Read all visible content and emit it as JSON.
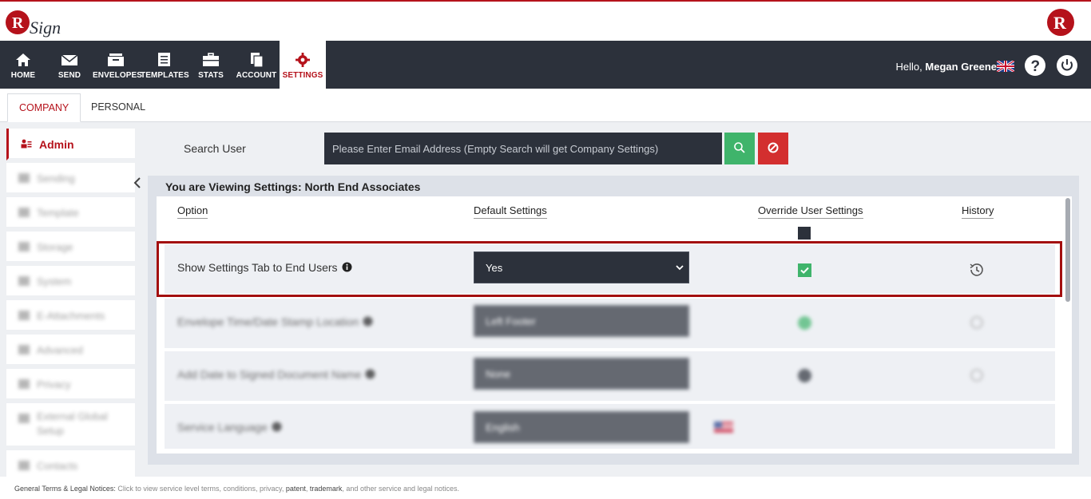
{
  "brand": {
    "logo_text": "RSign",
    "accent": "#b5121b"
  },
  "nav": {
    "items": [
      {
        "label": "HOME",
        "icon": "home-icon"
      },
      {
        "label": "SEND",
        "icon": "envelope-icon"
      },
      {
        "label": "ENVELOPES",
        "icon": "inbox-icon"
      },
      {
        "label": "TEMPLATES",
        "icon": "templates-icon"
      },
      {
        "label": "STATS",
        "icon": "briefcase-icon"
      },
      {
        "label": "ACCOUNT",
        "icon": "account-icon"
      },
      {
        "label": "SETTINGS",
        "icon": "gear-icon"
      }
    ],
    "greeting": "Hello,",
    "user_name": "Megan Greene"
  },
  "tabs": {
    "company": "COMPANY",
    "personal": "PERSONAL"
  },
  "sidebar": {
    "items": [
      {
        "label": "Admin"
      },
      {
        "label": "Sending"
      },
      {
        "label": "Template"
      },
      {
        "label": "Storage"
      },
      {
        "label": "System"
      },
      {
        "label": "E-Attachments"
      },
      {
        "label": "Advanced"
      },
      {
        "label": "Privacy"
      },
      {
        "label": "External Global Setup"
      },
      {
        "label": "Contacts"
      }
    ]
  },
  "search": {
    "label": "Search User",
    "placeholder": "Please Enter Email Address (Empty Search will get Company Settings)"
  },
  "settings_panel": {
    "title": "You are Viewing Settings: North End Associates",
    "columns": {
      "option": "Option",
      "default": "Default Settings",
      "override": "Override User Settings",
      "history": "History"
    },
    "rows": [
      {
        "option": "Show Settings Tab to End Users",
        "value": "Yes"
      },
      {
        "option": "Envelope Time/Date Stamp Location",
        "value": "Left Footer"
      },
      {
        "option": "Add Date to Signed Document Name",
        "value": "None"
      },
      {
        "option": "Service Language",
        "value": "English"
      }
    ]
  },
  "footer": {
    "label": "General Terms & Legal Notices:",
    "text_a": "Click to view service level terms, conditions, privacy,",
    "patent": "patent",
    "comma": ",",
    "trademark": "trademark",
    "text_b": ", and other service and legal notices."
  }
}
